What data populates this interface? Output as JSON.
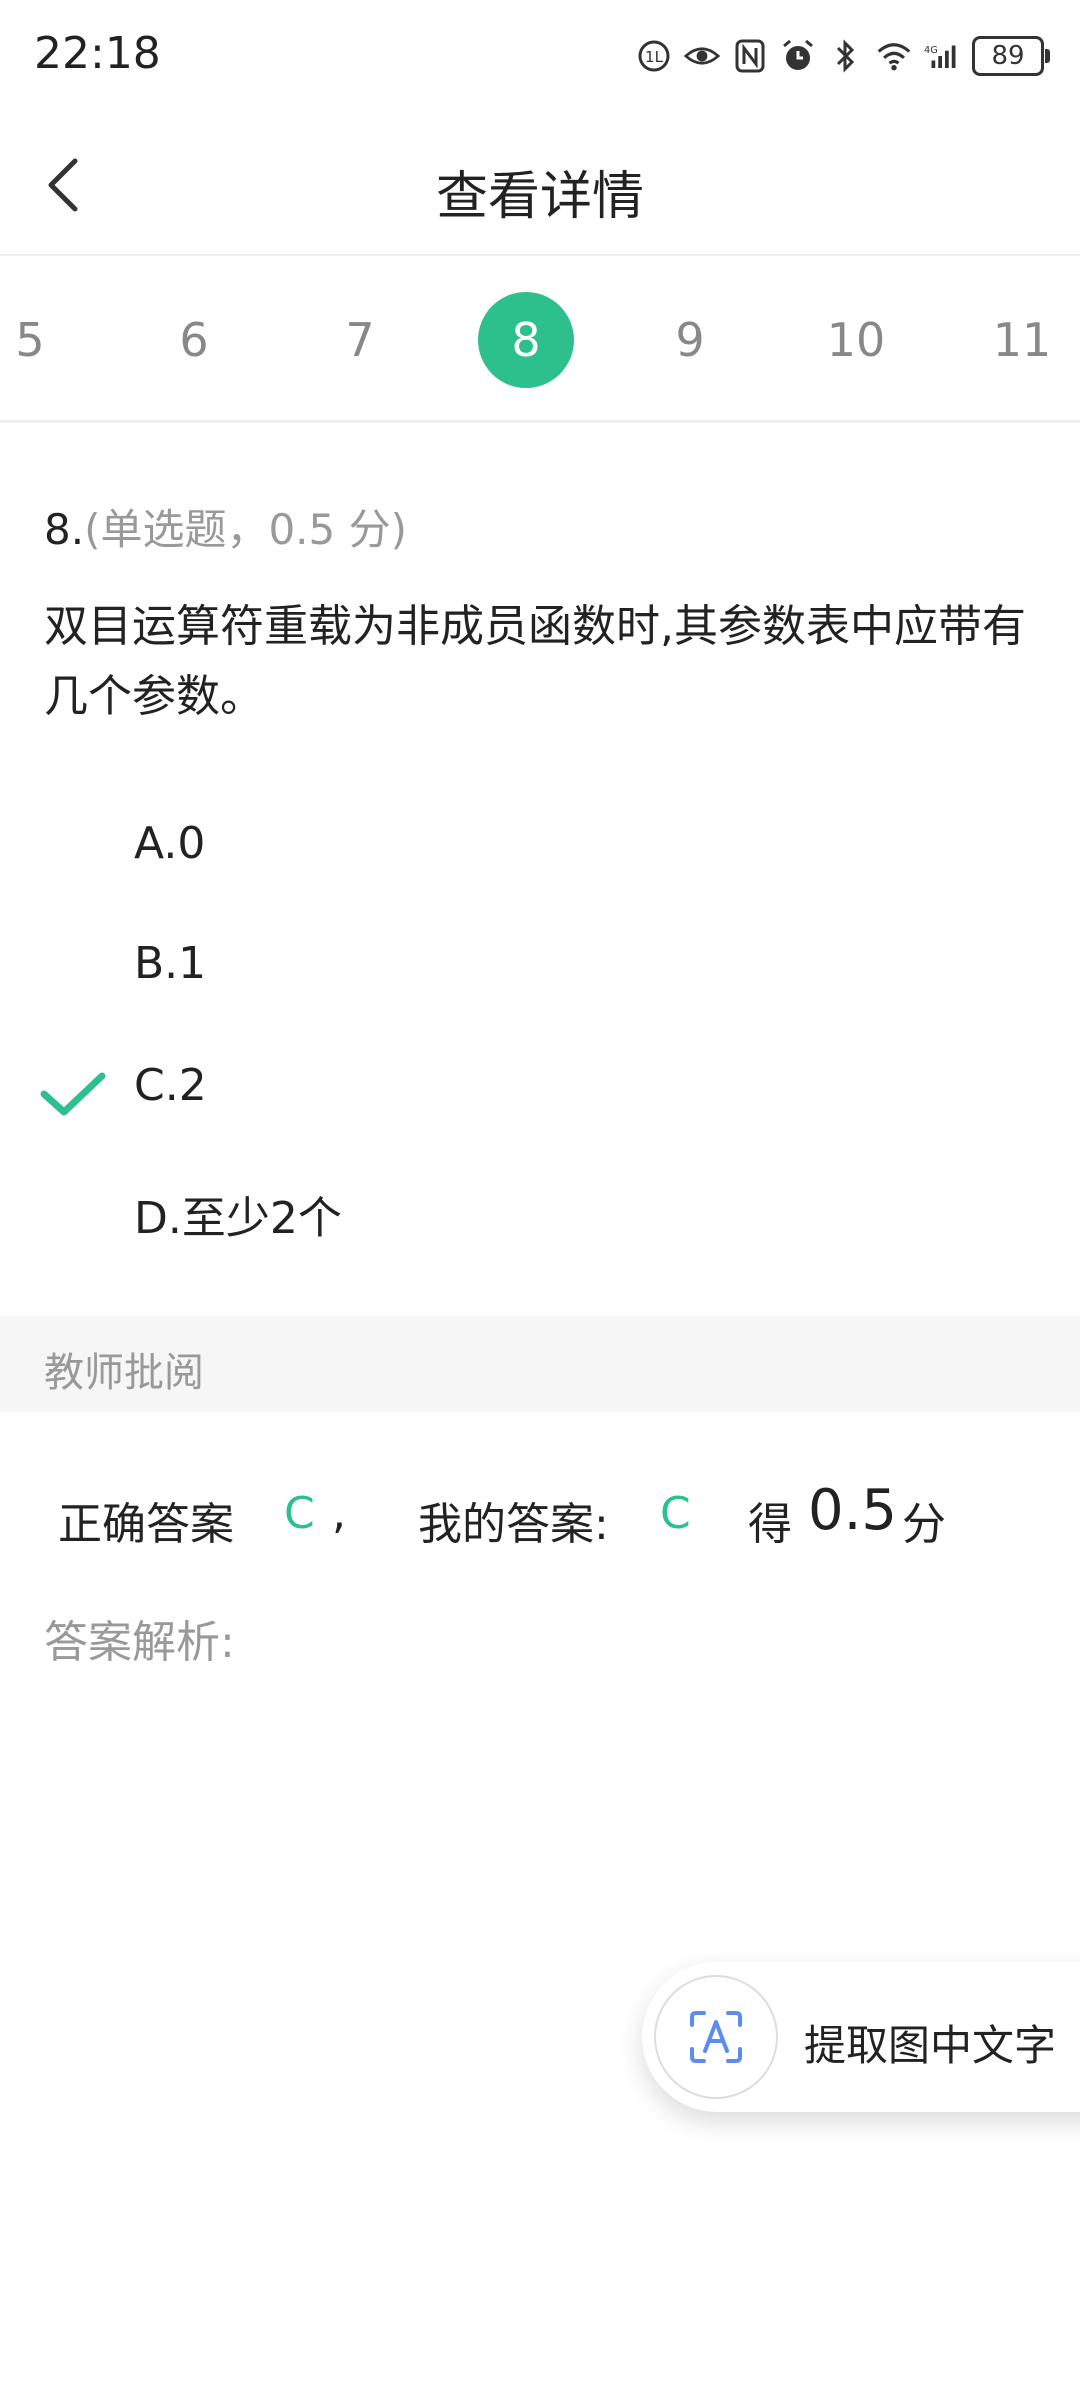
{
  "status_bar": {
    "time": "22:18",
    "battery": "89",
    "icons": [
      "hd-call-icon",
      "eye-icon",
      "nfc-icon",
      "alarm-icon",
      "bluetooth-icon",
      "wifi-icon",
      "signal-4g-icon"
    ]
  },
  "header": {
    "title": "查看详情",
    "back_icon": "chevron-left-icon"
  },
  "question_numbers": [
    "5",
    "6",
    "7",
    "8",
    "9",
    "10",
    "11"
  ],
  "active_question": "8",
  "colors": {
    "accent": "#2ec08c",
    "muted_text": "#999999",
    "review_bg": "#f6f6f6"
  },
  "question": {
    "number": "8.",
    "meta": "(单选题，0.5 分)",
    "text": "双目运算符重载为非成员函数时,其参数表中应带有几个参数。",
    "options": [
      {
        "label": "A.0",
        "selected": false
      },
      {
        "label": "B.1",
        "selected": false
      },
      {
        "label": "C.2",
        "selected": true
      },
      {
        "label": "D.至少2个",
        "selected": false
      }
    ]
  },
  "review": {
    "section_label": "教师批阅",
    "correct_label": "正确答案",
    "correct_value": "C",
    "separator": ",",
    "my_label": "我的答案:",
    "my_value": "C",
    "score_prefix": "得",
    "score_value": "0.5",
    "score_suffix": "分",
    "analysis_label": "答案解析:"
  },
  "float_button": {
    "label": "提取图中文字",
    "icon": "text-scan-icon"
  }
}
